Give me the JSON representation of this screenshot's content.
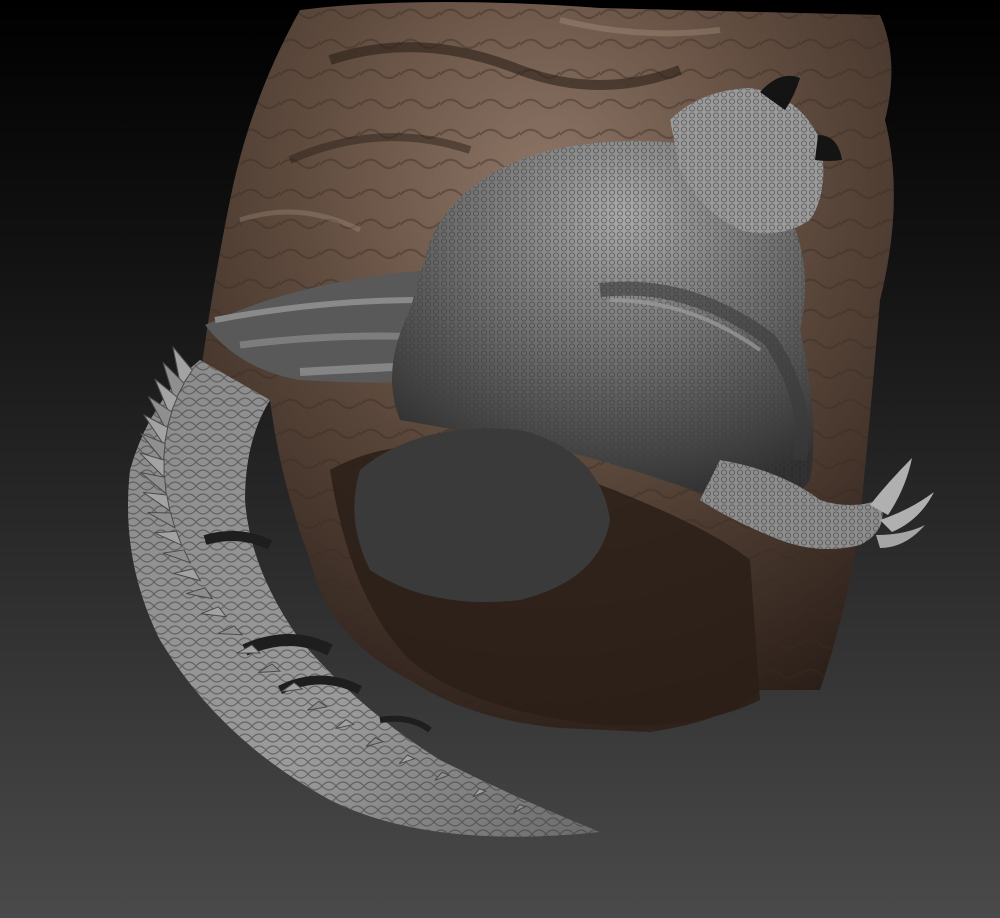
{
  "viewport": {
    "background_top": "#000000",
    "background_bottom": "#4a4a4a"
  },
  "palette": {
    "rock_light": "#8e7666",
    "rock_mid": "#5f4b3e",
    "rock_dark": "#2a1e18",
    "rock_shadow": "#1a120e",
    "scale_light": "#a9a9a9",
    "scale_mid": "#6e6e6e",
    "scale_dark": "#2e2e2e",
    "horn": "#141414"
  },
  "subject": {
    "rock": "sculpted-rock",
    "creature": "scaled-reptile-sculpt",
    "parts": [
      "head",
      "horns",
      "wing",
      "body",
      "leg",
      "claw",
      "tail",
      "tail-spines"
    ]
  }
}
